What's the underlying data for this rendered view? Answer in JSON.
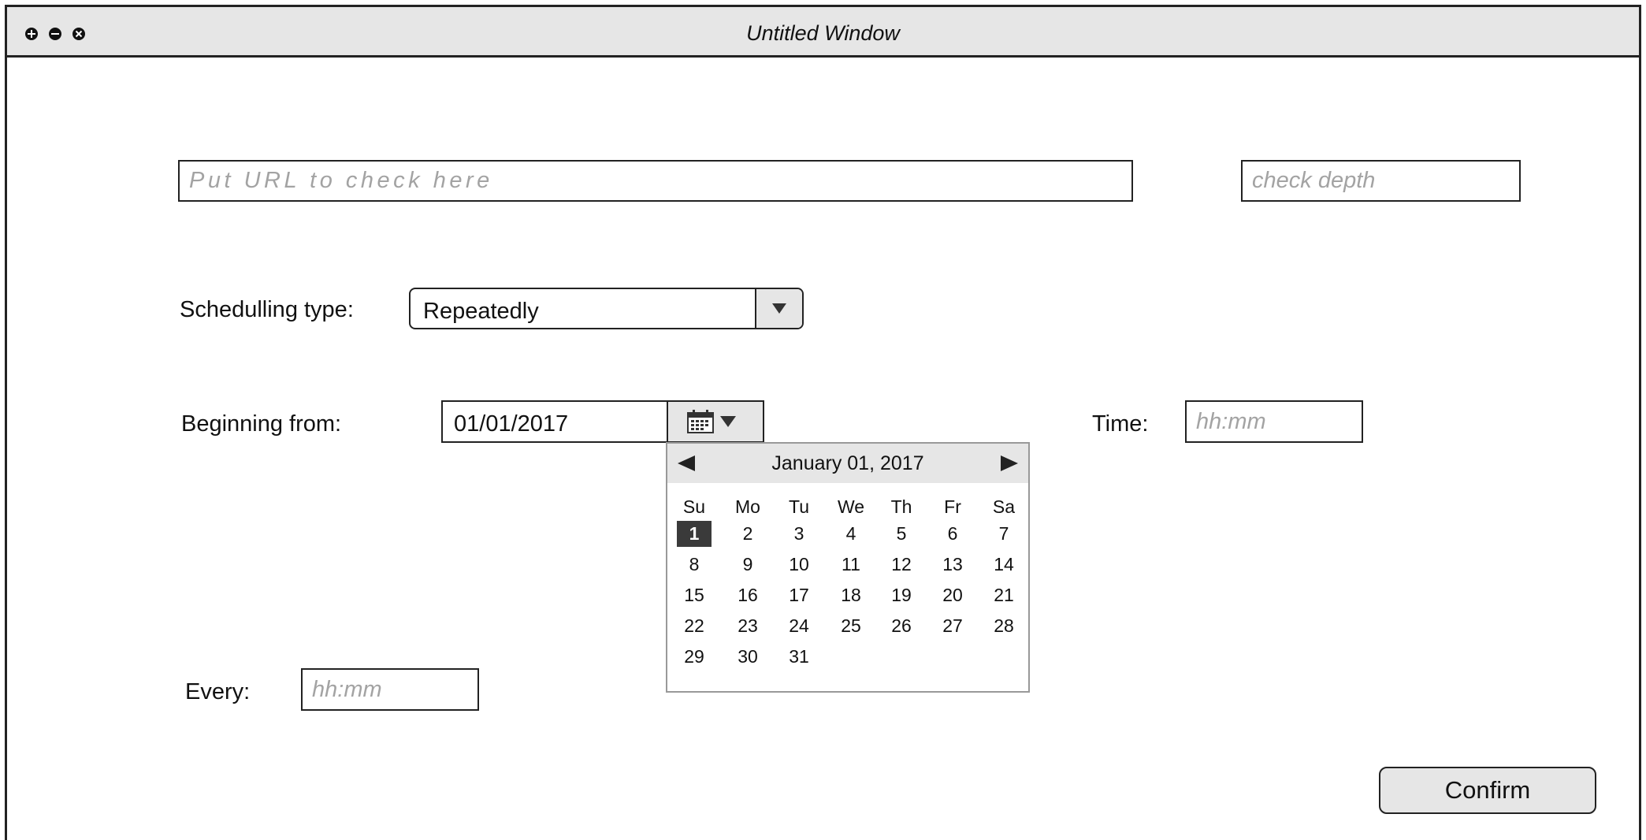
{
  "window": {
    "title": "Untitled Window"
  },
  "url_input": {
    "placeholder": "Put URL to check here",
    "value": ""
  },
  "depth_input": {
    "placeholder": "check depth",
    "value": ""
  },
  "scheduling": {
    "label": "Schedulling type:",
    "selected": "Repeatedly"
  },
  "begin": {
    "label": "Beginning from:",
    "date_value": "01/01/2017"
  },
  "time": {
    "label": "Time:",
    "placeholder": "hh:mm"
  },
  "every": {
    "label": "Every:",
    "placeholder": "hh:mm"
  },
  "calendar": {
    "header": "January 01, 2017",
    "weekdays": [
      "Su",
      "Mo",
      "Tu",
      "We",
      "Th",
      "Fr",
      "Sa"
    ],
    "first_weekday_index": 0,
    "days_in_month": 31,
    "selected_day": 1
  },
  "confirm": {
    "label": "Confirm"
  }
}
